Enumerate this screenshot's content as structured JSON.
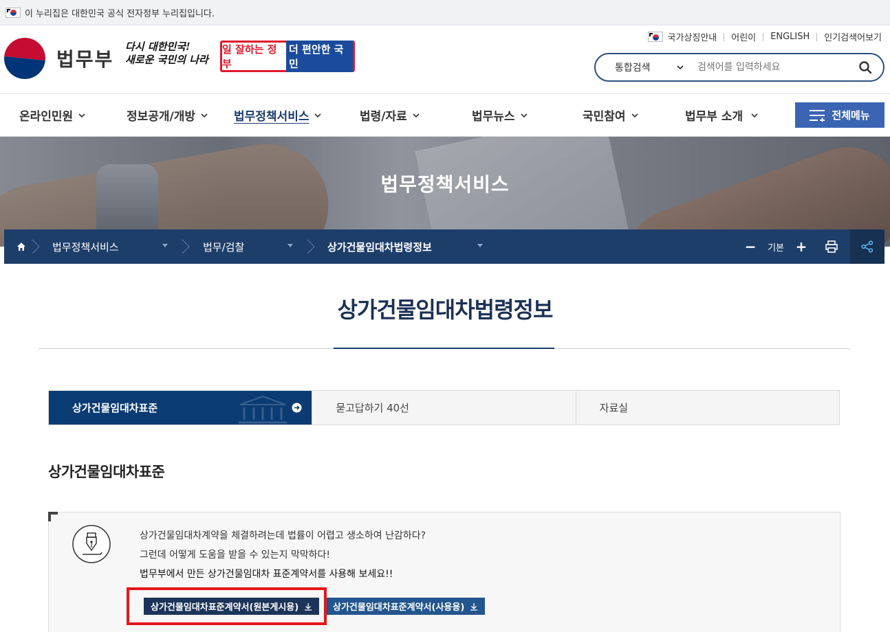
{
  "gov_bar": {
    "text": "이 누리집은 대한민국 공식 전자정부 누리집입니다."
  },
  "header": {
    "logo_text": "법무부",
    "slogan_line1": "다시 대한민국!",
    "slogan_line2": "새로운 국민의 나라",
    "slogan2_red": "일 잘하는 정부",
    "slogan2_blue": "더 편안한 국민",
    "util_links": [
      "국가상징안내",
      "어린이",
      "ENGLISH",
      "인기검색어보기"
    ],
    "search": {
      "scope": "통합검색",
      "placeholder": "검색어를 입력하세요"
    }
  },
  "gnb": {
    "items": [
      "온라인민원",
      "정보공개/개방",
      "법무정책서비스",
      "법령/자료",
      "법무뉴스",
      "국민참여",
      "법무부 소개"
    ],
    "active_index": 2,
    "all_menu": "전체메뉴"
  },
  "visual": {
    "title": "법무정책서비스"
  },
  "location": {
    "items": [
      "법무정책서비스",
      "법무/검찰",
      "상가건물임대차법령정보"
    ],
    "font_label": "기본",
    "minus": "−",
    "plus": "+"
  },
  "page": {
    "title": "상가건물임대차법령정보",
    "tabs": [
      "상가건물임대차표준",
      "묻고답하기 40선",
      "자료실"
    ],
    "active_tab": 0,
    "section_title": "상가건물임대차표준",
    "info_lines": [
      "상가건물임대차계약을 체결하려는데 법률이 어렵고 생소하여 난감하다?",
      "그런데 어떻게 도움을 받을 수 있는지 막막하다!",
      "법무부에서 만든 상가건물임대차 표준계약서를 사용해 보세요!!"
    ],
    "download_buttons": [
      "상가건물임대차표준계약서(원본게시용)",
      "상가건물임대차표준계약서(사용용)"
    ]
  },
  "colors": {
    "navy": "#1e3e6a",
    "tab_active": "#0b3b73",
    "all_menu": "#3b64b3",
    "highlight": "#e3161b"
  }
}
